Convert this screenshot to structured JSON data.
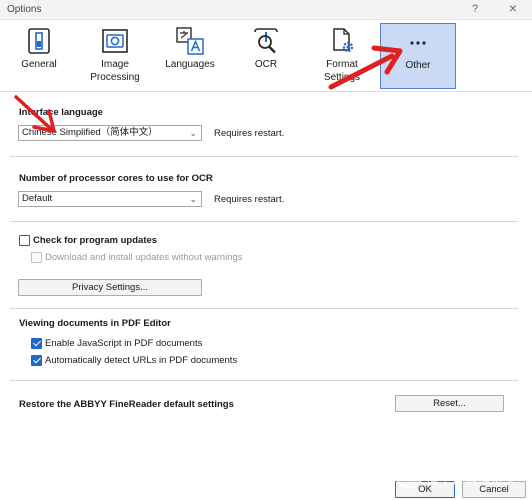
{
  "window": {
    "title": "Options",
    "help": "?",
    "close": "×"
  },
  "tabs": [
    {
      "label": "General",
      "icon": "general-icon"
    },
    {
      "label": "Image Processing",
      "icon": "camera-icon"
    },
    {
      "label": "Languages",
      "icon": "languages-icon"
    },
    {
      "label": "OCR",
      "icon": "ocr-icon"
    },
    {
      "label": "Format Settings",
      "icon": "format-settings-icon"
    },
    {
      "label": "Other",
      "icon": "more-icon",
      "active": true
    }
  ],
  "interface": {
    "heading": "Interface language",
    "value": "Chinese Simplified（简体中文）",
    "note": "Requires restart."
  },
  "cores": {
    "heading": "Number of processor cores to use for OCR",
    "value": "Default",
    "note": "Requires restart."
  },
  "updates": {
    "check_label": "Check for program updates",
    "check_on": false,
    "install_label": "Download and install updates without warnings",
    "install_on": false,
    "privacy_button": "Privacy Settings..."
  },
  "pdf": {
    "heading": "Viewing documents in PDF Editor",
    "js_label": "Enable JavaScript in PDF documents",
    "js_on": true,
    "url_label": "Automatically detect URLs in PDF documents",
    "url_on": true
  },
  "restore": {
    "label": "Restore the ABBYY FineReader default settings",
    "button": "Reset..."
  },
  "footer": {
    "ok": "OK",
    "cancel": "Cancel"
  },
  "watermark": {
    "brand": "值 | 什么值得买"
  },
  "colors": {
    "accent": "#2168c7",
    "active_tab": "#cbdaf4",
    "annotation_arrow": "#e02020"
  }
}
